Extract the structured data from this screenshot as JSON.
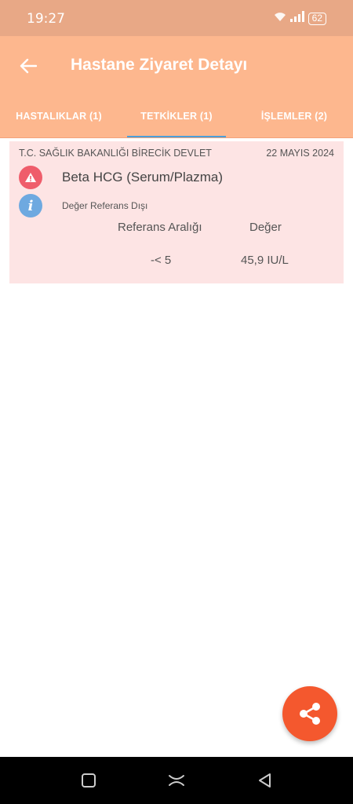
{
  "status": {
    "time": "19:27",
    "battery": "62"
  },
  "header": {
    "title": "Hastane Ziyaret Detayı"
  },
  "tabs": [
    {
      "label": "HASTALIKLAR (1)"
    },
    {
      "label": "TETKİKLER (1)"
    },
    {
      "label": "İŞLEMLER (2)"
    }
  ],
  "card": {
    "hospital": "T.C. SAĞLIK BAKANLIĞI BİRECİK DEVLET",
    "date": "22 MAYIS 2024",
    "test_name": "Beta HCG (Serum/Plazma)",
    "status_text": "Değer Referans Dışı",
    "ref_header": "Referans Aralığı",
    "value_header": "Değer",
    "ref_value": "-< 5",
    "value": "45,9 IU/L"
  },
  "colors": {
    "app_bar": "#fdb78e",
    "status_bar": "#e8a886",
    "card_bg": "#fde4e4",
    "fab": "#f4582e",
    "tab_indicator": "#4a9fd9"
  }
}
